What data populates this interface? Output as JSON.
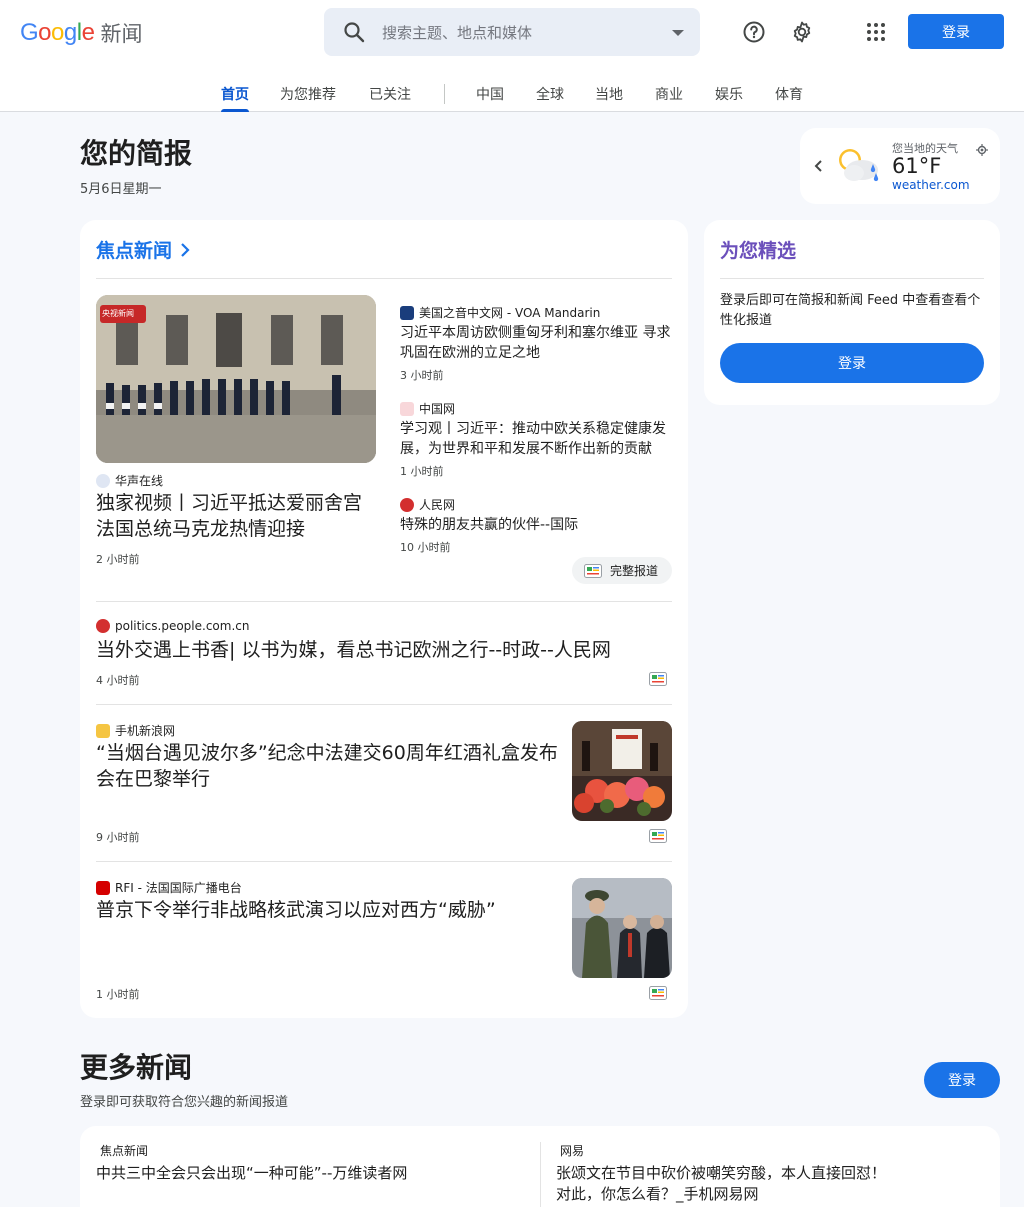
{
  "header": {
    "logo_letters": [
      "G",
      "o",
      "o",
      "g",
      "l",
      "e"
    ],
    "logo_product": "新闻",
    "search_placeholder": "搜索主题、地点和媒体",
    "login_label": "登录"
  },
  "tabs": [
    {
      "label": "首页",
      "active": true
    },
    {
      "label": "为您推荐",
      "active": false
    },
    {
      "label": "已关注",
      "active": false
    },
    {
      "label": "中国",
      "active": false
    },
    {
      "label": "全球",
      "active": false
    },
    {
      "label": "当地",
      "active": false
    },
    {
      "label": "商业",
      "active": false
    },
    {
      "label": "娱乐",
      "active": false
    },
    {
      "label": "体育",
      "active": false
    }
  ],
  "briefing": {
    "title": "您的简报",
    "date": "5月6日星期一"
  },
  "weather": {
    "label": "您当地的天气",
    "temp": "61°F",
    "source": "weather.com"
  },
  "top_stories": {
    "title": "焦点新闻",
    "hero": {
      "source": "华声在线",
      "headline": "独家视频丨习近平抵达爱丽舍宫 法国总统马克龙热情迎接",
      "time": "2 小时前",
      "image_badge": "央视新闻"
    },
    "side": [
      {
        "source": "美国之音中文网 - VOA Mandarin",
        "headline": "习近平本周访欧侧重匈牙利和塞尔维亚 寻求巩固在欧洲的立足之地",
        "time": "3 小时前"
      },
      {
        "source": "中国网",
        "headline": "学习观丨习近平：推动中欧关系稳定健康发展，为世界和平和发展不断作出新的贡献",
        "time": "1 小时前"
      },
      {
        "source": "人民网",
        "headline": "特殊的朋友共赢的伙伴--国际",
        "time": "10 小时前"
      }
    ],
    "full_coverage": "完整报道",
    "stories": [
      {
        "source": "politics.people.com.cn",
        "headline": "当外交遇上书香| 以书为媒，看总书记欧洲之行--时政--人民网",
        "time": "4 小时前"
      },
      {
        "source": "手机新浪网",
        "headline": "“当烟台遇见波尔多”纪念中法建交60周年红酒礼盒发布会在巴黎举行",
        "time": "9 小时前"
      },
      {
        "source": "RFI - 法国国际广播电台",
        "headline": "普京下令举行非战略核武演习以应对西方“威胁”",
        "time": "1 小时前"
      }
    ]
  },
  "for_you": {
    "title": "为您精选",
    "description": "登录后即可在简报和新闻 Feed 中查看查看个性化报道",
    "button": "登录"
  },
  "more_news": {
    "title": "更多新闻",
    "subtitle": "登录即可获取符合您兴趣的新闻报道",
    "button": "登录",
    "items": [
      {
        "source": "焦点新闻",
        "headline": "中共三中全会只会出现“一种可能”--万维读者网"
      },
      {
        "source": "网易",
        "headline": "张颂文在节目中砍价被嘲笑穷酸，本人直接回怼！对此，你怎么看？_手机网易网"
      }
    ]
  },
  "colors": {
    "accent": "#1a73e8",
    "for_you_title": "#6b4fbb",
    "background": "#f6f8fc"
  }
}
